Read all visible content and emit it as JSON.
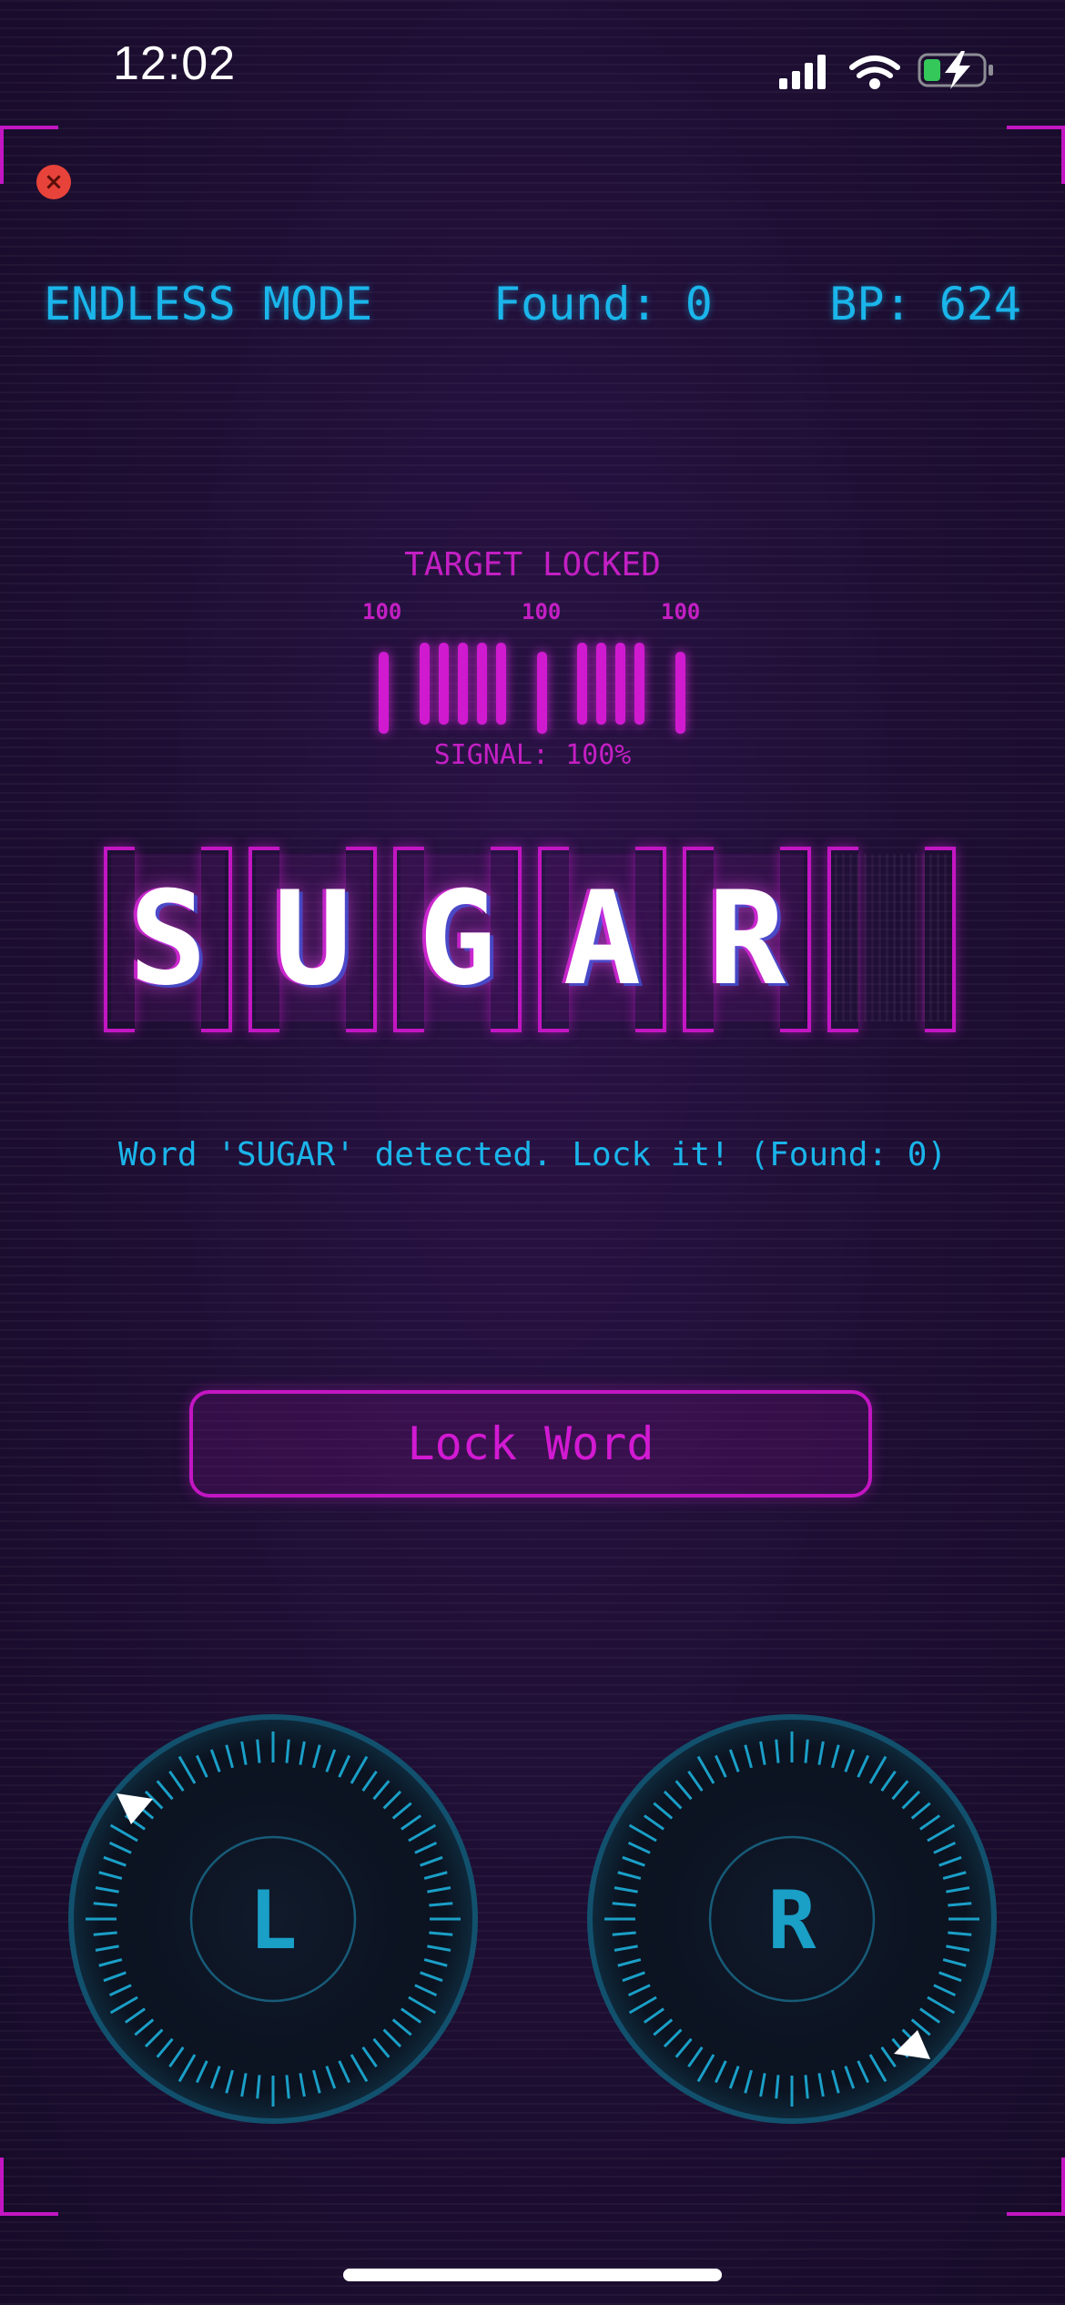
{
  "status_bar": {
    "time": "12:02",
    "icons": [
      "signal-icon",
      "wifi-icon",
      "battery-charging-icon"
    ]
  },
  "header": {
    "close_icon": "×",
    "mode": "ENDLESS MODE",
    "found": "Found: 0",
    "bp": "BP: 624"
  },
  "signal": {
    "title": "TARGET LOCKED",
    "readouts": [
      "100",
      "100",
      "100"
    ],
    "status": "SIGNAL: 100%",
    "level_percent": 100
  },
  "word": {
    "letters": [
      "S",
      "U",
      "G",
      "A",
      "R",
      ""
    ]
  },
  "message": "Word 'SUGAR' detected. Lock it! (Found: 0)",
  "lock_button": "Lock Word",
  "knobs": {
    "left_label": "L",
    "right_label": "R"
  },
  "colors": {
    "accent_cyan": "#1ab5ea",
    "accent_magenta": "#c316c3",
    "background": "#1f0f35",
    "close_red": "#e8433a"
  }
}
